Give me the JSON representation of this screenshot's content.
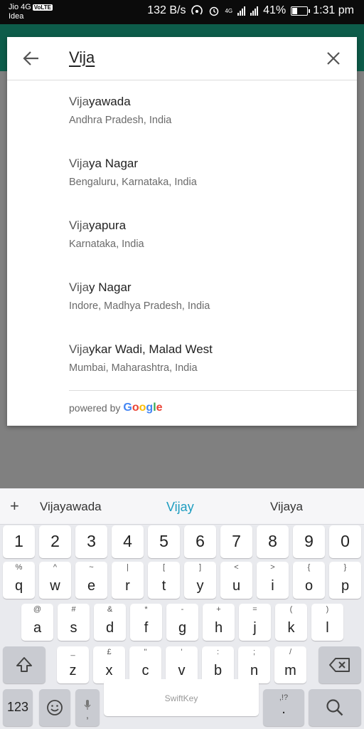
{
  "status": {
    "carrier1": "Jio 4G",
    "volte": "VoLTE",
    "carrier2": "Idea",
    "speed": "132 B/s",
    "network": "4G",
    "battery": "41%",
    "battery_level": 0.41,
    "time": "1:31 pm"
  },
  "search": {
    "query": "Vija"
  },
  "results": [
    {
      "match": "Vija",
      "rest": "yawada",
      "sub": "Andhra Pradesh, India"
    },
    {
      "match": "Vija",
      "rest": "ya Nagar",
      "sub": "Bengaluru, Karnataka, India"
    },
    {
      "match": "Vija",
      "rest": "yapura",
      "sub": "Karnataka, India"
    },
    {
      "match": "Vija",
      "rest": "y Nagar",
      "sub": "Indore, Madhya Pradesh, India"
    },
    {
      "match": "Vija",
      "rest": "ykar Wadi, Malad West",
      "sub": "Mumbai, Maharashtra, India"
    }
  ],
  "powered_by": {
    "prefix": "powered by",
    "brand": [
      "G",
      "o",
      "o",
      "g",
      "l",
      "e"
    ],
    "brand_colors": [
      "#4285F4",
      "#EA4335",
      "#FBBC05",
      "#4285F4",
      "#34A853",
      "#EA4335"
    ]
  },
  "keyboard": {
    "suggestions": {
      "left": "Vijayawada",
      "middle": "Vijay",
      "right": "Vijaya",
      "plus": "+"
    },
    "numbers": [
      "1",
      "2",
      "3",
      "4",
      "5",
      "6",
      "7",
      "8",
      "9",
      "0"
    ],
    "row1": [
      {
        "m": "q",
        "a": "%"
      },
      {
        "m": "w",
        "a": "^"
      },
      {
        "m": "e",
        "a": "~"
      },
      {
        "m": "r",
        "a": "|"
      },
      {
        "m": "t",
        "a": "["
      },
      {
        "m": "y",
        "a": "]"
      },
      {
        "m": "u",
        "a": "<"
      },
      {
        "m": "i",
        "a": ">"
      },
      {
        "m": "o",
        "a": "{"
      },
      {
        "m": "p",
        "a": "}"
      }
    ],
    "row2": [
      {
        "m": "a",
        "a": "@"
      },
      {
        "m": "s",
        "a": "#"
      },
      {
        "m": "d",
        "a": "&"
      },
      {
        "m": "f",
        "a": "*"
      },
      {
        "m": "g",
        "a": "-"
      },
      {
        "m": "h",
        "a": "+"
      },
      {
        "m": "j",
        "a": "="
      },
      {
        "m": "k",
        "a": "("
      },
      {
        "m": "l",
        "a": ")"
      }
    ],
    "row3": [
      {
        "m": "z",
        "a": "_"
      },
      {
        "m": "x",
        "a": "£"
      },
      {
        "m": "c",
        "a": "\""
      },
      {
        "m": "v",
        "a": "'"
      },
      {
        "m": "b",
        "a": ":"
      },
      {
        "m": "n",
        "a": ";"
      },
      {
        "m": "m",
        "a": "/"
      }
    ],
    "symbols_label": "123",
    "space_label": "SwiftKey",
    "period_label": ".",
    "period_alt": ",!?"
  },
  "icons": {
    "back": "arrow-left-icon",
    "clear": "close-icon",
    "shift": "shift-icon",
    "backspace": "backspace-icon",
    "emoji": "emoji-icon",
    "mic": "mic-icon",
    "search": "search-icon"
  }
}
